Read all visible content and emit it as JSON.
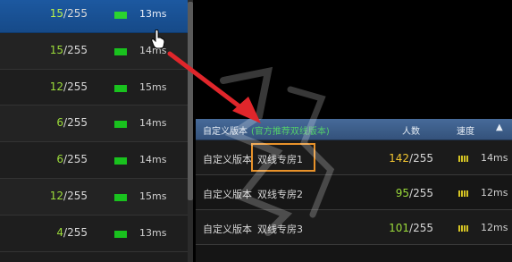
{
  "left_list": {
    "rows": [
      {
        "current": "15",
        "max": "/255",
        "ping": "13ms",
        "selected": true
      },
      {
        "current": "15",
        "max": "/255",
        "ping": "14ms",
        "selected": false
      },
      {
        "current": "12",
        "max": "/255",
        "ping": "15ms",
        "selected": false
      },
      {
        "current": "6",
        "max": "/255",
        "ping": "14ms",
        "selected": false
      },
      {
        "current": "6",
        "max": "/255",
        "ping": "14ms",
        "selected": false
      },
      {
        "current": "12",
        "max": "/255",
        "ping": "15ms",
        "selected": false
      },
      {
        "current": "4",
        "max": "/255",
        "ping": "13ms",
        "selected": false
      }
    ]
  },
  "right_table": {
    "header": {
      "name_label": "自定义版本",
      "name_sub": "(官方推荐双线版本)",
      "count_label": "人数",
      "speed_label": "速度",
      "sort_icon": "▲"
    },
    "rows": [
      {
        "version": "自定义版本",
        "server": "双线专房1",
        "current": "142",
        "max": "/255",
        "ping": "14ms",
        "busy": true
      },
      {
        "version": "自定义版本",
        "server": "双线专房2",
        "current": "95",
        "max": "/255",
        "ping": "12ms",
        "busy": false
      },
      {
        "version": "自定义版本",
        "server": "双线专房3",
        "current": "101",
        "max": "/255",
        "ping": "12ms",
        "busy": false
      }
    ]
  },
  "colors": {
    "selected_row": "#1d5aa3",
    "signal_green": "#19c21e",
    "count_green": "#9bdb3a",
    "count_busy": "#f2c531",
    "arrow_red": "#e0262b",
    "highlight_orange": "#e8922a",
    "header_blue": "#466a99"
  },
  "icons": {
    "cursor": "hand-pointer-icon",
    "arrow": "red-annotation-arrow",
    "signal": "signal-bars-icon"
  }
}
